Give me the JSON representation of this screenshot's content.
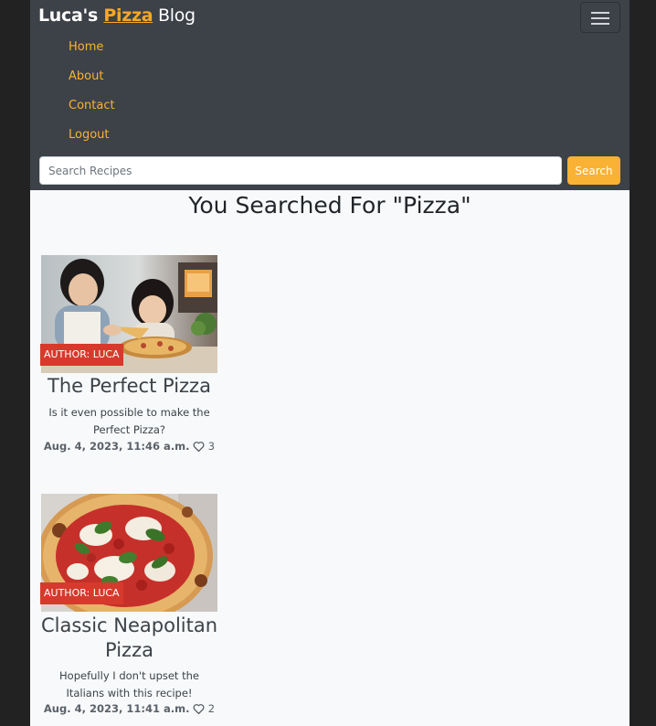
{
  "brand": {
    "part1": "Luca's ",
    "part2": "Pizza",
    "part3": " Blog"
  },
  "nav": {
    "toggler_icon": "hamburger-icon",
    "links": [
      "Home",
      "About",
      "Contact",
      "Logout"
    ]
  },
  "search": {
    "placeholder": "Search Recipes",
    "value": "",
    "button_label": "Search"
  },
  "results": {
    "heading": "You Searched For \"Pizza\"",
    "cards": [
      {
        "image": "two girls making pizza photo",
        "author": "AUTHOR: LUCA",
        "title": "The Perfect Pizza",
        "description": "Is it even possible to make the Perfect Pizza?",
        "date": "Aug. 4, 2023, 11:46 a.m.",
        "likes": "3"
      },
      {
        "image": "neapolitan pizza photo",
        "author": "AUTHOR: LUCA",
        "title": "Classic Neapolitan Pizza",
        "description": "Hopefully I don't upset the Italians with this recipe!",
        "date": "Aug. 4, 2023, 11:41 a.m.",
        "likes": "2"
      }
    ]
  },
  "colors": {
    "navbar_bg": "#3d4148",
    "accent": "#f9b233",
    "badge": "#d63a2c",
    "page_bg": "#f8f9fa"
  }
}
